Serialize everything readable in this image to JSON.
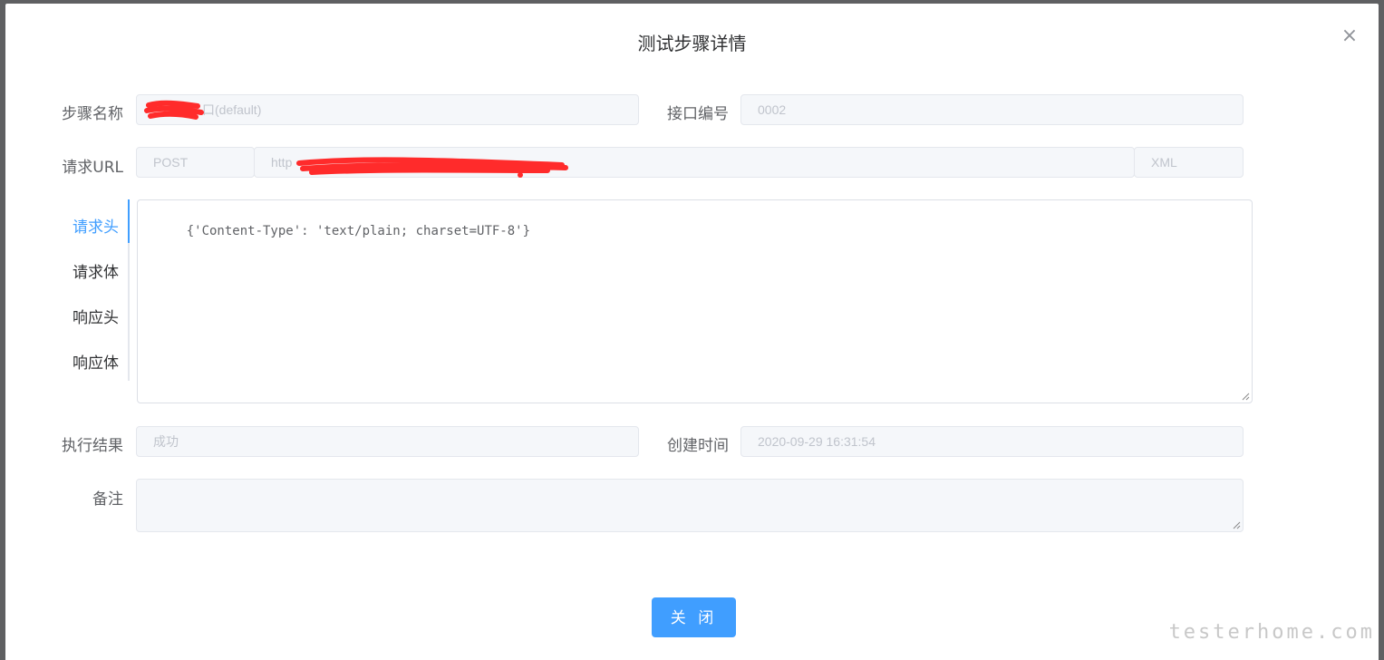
{
  "dialog": {
    "title": "测试步骤详情",
    "close_icon": "×"
  },
  "form": {
    "step_name_label": "步骤名称",
    "step_name_value": "口(default)",
    "api_no_label": "接口编号",
    "api_no_value": "0002",
    "url_label": "请求URL",
    "method_value": "POST",
    "url_value": "http",
    "format_value": "XML",
    "result_label": "执行结果",
    "result_value": "成功",
    "created_label": "创建时间",
    "created_value": "2020-09-29 16:31:54",
    "remark_label": "备注",
    "remark_value": ""
  },
  "tabs": [
    {
      "label": "请求头"
    },
    {
      "label": "请求体"
    },
    {
      "label": "响应头"
    },
    {
      "label": "响应体"
    }
  ],
  "headers_content": "{'Content-Type': 'text/plain; charset=UTF-8'}",
  "footer": {
    "close_button": "关 闭"
  },
  "watermark": "testerhome.com",
  "colors": {
    "accent": "#409eff",
    "redaction": "#ff2b2b"
  }
}
